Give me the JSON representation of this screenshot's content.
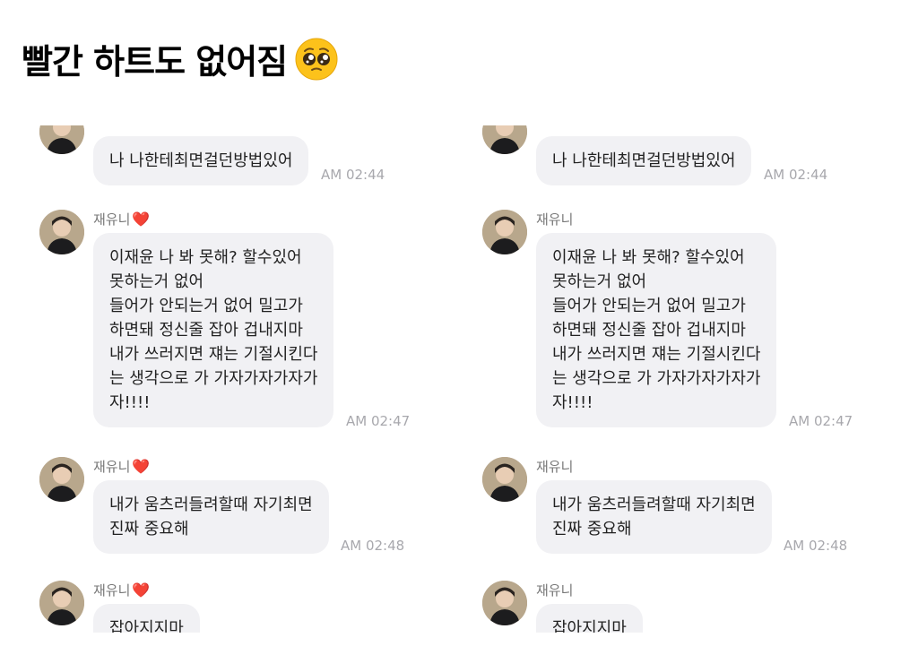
{
  "title": "빨간 하트도 없어짐",
  "title_emoji": "pleading-face",
  "panels": [
    {
      "side": "left",
      "messages": [
        {
          "lines": [
            "나 나한테최면걸던방법있어"
          ],
          "time": "AM 02:44"
        },
        {
          "sender": "재유니",
          "heart": "❤️",
          "lines": [
            "이재윤 나 봐 못해? 할수있어",
            "못하는거 없어",
            "들어가 안되는거 없어 밀고가",
            "하면돼 정신줄 잡아 겁내지마",
            "내가 쓰러지면 쟤는 기절시킨다",
            "는 생각으로 가 가자가자가자가",
            "자!!!!"
          ],
          "time": "AM 02:47"
        },
        {
          "sender": "재유니",
          "heart": "❤️",
          "lines": [
            "내가 움츠러들려할때 자기최면",
            "진짜 중요해"
          ],
          "time": "AM 02:48"
        },
        {
          "sender": "재유니",
          "heart": "❤️",
          "lines": [
            "잡아지지마"
          ]
        }
      ]
    },
    {
      "side": "right",
      "messages": [
        {
          "lines": [
            "나 나한테최면걸던방법있어"
          ],
          "time": "AM 02:44"
        },
        {
          "sender": "재유니",
          "heart": "",
          "lines": [
            "이재윤 나 봐 못해? 할수있어",
            "못하는거 없어",
            "들어가 안되는거 없어 밀고가",
            "하면돼 정신줄 잡아 겁내지마",
            "내가 쓰러지면 쟤는 기절시킨다",
            "는 생각으로 가 가자가자가자가",
            "자!!!!"
          ],
          "time": "AM 02:47"
        },
        {
          "sender": "재유니",
          "heart": "",
          "lines": [
            "내가 움츠러들려할때 자기최면",
            "진짜 중요해"
          ],
          "time": "AM 02:48"
        },
        {
          "sender": "재유니",
          "heart": "",
          "lines": [
            "잡아지지마"
          ]
        }
      ]
    }
  ],
  "colors": {
    "bubble": "#f1f1f4",
    "time": "#a8a8ad",
    "sender": "#777777",
    "heart": "#e0202e"
  }
}
